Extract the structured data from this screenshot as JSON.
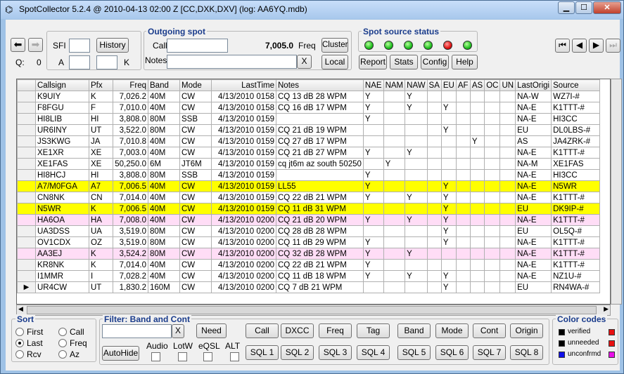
{
  "window": {
    "title": "SpotCollector 5.2.4 @ 2010-04-13  02:00 Z [CC,DXK,DXV]  (log: AA6YQ.mdb)",
    "app_icon": "binoculars-icon"
  },
  "sfi": {
    "label": "SFI",
    "value": ""
  },
  "a": {
    "label": "A",
    "value": ""
  },
  "k": {
    "label": "K",
    "value": ""
  },
  "q": {
    "label": "Q:",
    "value": "0"
  },
  "history_label": "History",
  "outgoing": {
    "title": "Outgoing spot",
    "call_label": "Call",
    "call_value": "",
    "freq_value": "7,005.0",
    "freq_label": "Freq",
    "notes_label": "Notes",
    "notes_value": "",
    "clear_label": "X",
    "cluster_label": "Cluster",
    "local_label": "Local"
  },
  "status": {
    "title": "Spot source status",
    "leds": [
      "#1fbf1f",
      "#1fbf1f",
      "#1fbf1f",
      "#1fbf1f",
      "#e01010",
      "#1fbf1f"
    ],
    "buttons": [
      "Report",
      "Stats",
      "Config",
      "Help"
    ]
  },
  "columns": [
    "",
    "Callsign",
    "Pfx",
    "Freq",
    "Band",
    "Mode",
    "LastTime",
    "Notes",
    "NAE",
    "NAM",
    "NAW",
    "SA",
    "EU",
    "AF",
    "AS",
    "OC",
    "UN",
    "LastOrigi",
    "Source"
  ],
  "rows": [
    {
      "style": "",
      "ind": "",
      "cells": [
        "K9UIY",
        "K",
        "7,026.2",
        "40M",
        "CW",
        "4/13/2010 0158",
        "CQ    13 dB 28 WPM",
        "Y",
        "",
        "Y",
        "",
        "",
        "",
        "",
        "",
        "",
        "NA-W",
        "WZ7I-#"
      ]
    },
    {
      "style": "",
      "ind": "",
      "cells": [
        "F8FGU",
        "F",
        "7,010.0",
        "40M",
        "CW",
        "4/13/2010 0158",
        "CQ    16 dB 17 WPM",
        "Y",
        "",
        "Y",
        "",
        "Y",
        "",
        "",
        "",
        "",
        "NA-E",
        "K1TTT-#"
      ]
    },
    {
      "style": "",
      "ind": "",
      "cells": [
        "HI8LIB",
        "HI",
        "3,808.0",
        "80M",
        "SSB",
        "4/13/2010 0159",
        "",
        "Y",
        "",
        "",
        "",
        "",
        "",
        "",
        "",
        "",
        "NA-E",
        "HI3CC"
      ]
    },
    {
      "style": "",
      "ind": "",
      "cells": [
        "UR6INY",
        "UT",
        "3,522.0",
        "80M",
        "CW",
        "4/13/2010 0159",
        "CQ    21 dB 19 WPM",
        "",
        "",
        "",
        "",
        "Y",
        "",
        "",
        "",
        "",
        "EU",
        "DL0LBS-#"
      ]
    },
    {
      "style": "",
      "ind": "",
      "cells": [
        "JS3KWG",
        "JA",
        "7,010.8",
        "40M",
        "CW",
        "4/13/2010 0159",
        "CQ    27 dB 17 WPM",
        "",
        "",
        "",
        "",
        "",
        "",
        "Y",
        "",
        "",
        "AS",
        "JA4ZRK-#"
      ]
    },
    {
      "style": "",
      "ind": "",
      "cells": [
        "XE1XR",
        "XE",
        "7,003.0",
        "40M",
        "CW",
        "4/13/2010 0159",
        "CQ    21 dB 27 WPM",
        "Y",
        "",
        "Y",
        "",
        "",
        "",
        "",
        "",
        "",
        "NA-E",
        "K1TTT-#"
      ]
    },
    {
      "style": "",
      "ind": "",
      "cells": [
        "XE1FAS",
        "XE",
        "50,250.0",
        "6M",
        "JT6M",
        "4/13/2010 0159",
        "cq jt6m az south 50250",
        "",
        "Y",
        "",
        "",
        "",
        "",
        "",
        "",
        "",
        "NA-M",
        "XE1FAS"
      ]
    },
    {
      "style": "",
      "ind": "",
      "cells": [
        "HI8HCJ",
        "HI",
        "3,808.0",
        "80M",
        "SSB",
        "4/13/2010 0159",
        "",
        "Y",
        "",
        "",
        "",
        "",
        "",
        "",
        "",
        "",
        "NA-E",
        "HI3CC"
      ]
    },
    {
      "style": "yel",
      "ind": "",
      "cells": [
        "A7/M0FGA",
        "A7",
        "7,006.5",
        "40M",
        "CW",
        "4/13/2010 0159",
        "LL55",
        "Y",
        "",
        "",
        "",
        "Y",
        "",
        "",
        "",
        "",
        "NA-E",
        "N5WR"
      ]
    },
    {
      "style": "",
      "ind": "",
      "cells": [
        "CN8NK",
        "CN",
        "7,014.0",
        "40M",
        "CW",
        "4/13/2010 0159",
        "CQ    22 dB 21 WPM",
        "Y",
        "",
        "Y",
        "",
        "Y",
        "",
        "",
        "",
        "",
        "NA-E",
        "K1TTT-#"
      ]
    },
    {
      "style": "yel",
      "ind": "",
      "cells": [
        "N5WR",
        "K",
        "7,006.5",
        "40M",
        "CW",
        "4/13/2010 0159",
        "CQ    11 dB 31 WPM",
        "",
        "",
        "",
        "",
        "Y",
        "",
        "",
        "",
        "",
        "EU",
        "DK9IP-#"
      ]
    },
    {
      "style": "pink",
      "ind": "",
      "cells": [
        "HA6OA",
        "HA",
        "7,008.0",
        "40M",
        "CW",
        "4/13/2010 0200",
        "CQ    21 dB 20 WPM",
        "Y",
        "",
        "Y",
        "",
        "Y",
        "",
        "",
        "",
        "",
        "NA-E",
        "K1TTT-#"
      ]
    },
    {
      "style": "",
      "ind": "",
      "cells": [
        "UA3DSS",
        "UA",
        "3,519.0",
        "80M",
        "CW",
        "4/13/2010 0200",
        "CQ    28 dB 28 WPM",
        "",
        "",
        "",
        "",
        "Y",
        "",
        "",
        "",
        "",
        "EU",
        "OL5Q-#"
      ]
    },
    {
      "style": "",
      "ind": "",
      "cells": [
        "OV1CDX",
        "OZ",
        "3,519.0",
        "80M",
        "CW",
        "4/13/2010 0200",
        "CQ    11 dB 29 WPM",
        "Y",
        "",
        "",
        "",
        "Y",
        "",
        "",
        "",
        "",
        "NA-E",
        "K1TTT-#"
      ]
    },
    {
      "style": "pink",
      "ind": "",
      "cells": [
        "AA3EJ",
        "K",
        "3,524.2",
        "80M",
        "CW",
        "4/13/2010 0200",
        "CQ    32 dB 28 WPM",
        "Y",
        "",
        "Y",
        "",
        "",
        "",
        "",
        "",
        "",
        "NA-E",
        "K1TTT-#"
      ]
    },
    {
      "style": "",
      "ind": "",
      "cells": [
        "KR8NK",
        "K",
        "7,014.0",
        "40M",
        "CW",
        "4/13/2010 0200",
        "CQ    22 dB 21 WPM",
        "Y",
        "",
        "",
        "",
        "",
        "",
        "",
        "",
        "",
        "NA-E",
        "K1TTT-#"
      ]
    },
    {
      "style": "",
      "ind": "",
      "cells": [
        "I1MMR",
        "I",
        "7,028.2",
        "40M",
        "CW",
        "4/13/2010 0200",
        "CQ    11 dB 18 WPM",
        "Y",
        "",
        "Y",
        "",
        "Y",
        "",
        "",
        "",
        "",
        "NA-E",
        "NZ1U-#"
      ]
    },
    {
      "style": "",
      "ind": "▶",
      "cells": [
        "UR4CW",
        "UT",
        "1,830.2",
        "160M",
        "CW",
        "4/13/2010 0200",
        "CQ    7 dB 21 WPM",
        "",
        "",
        "",
        "",
        "Y",
        "",
        "",
        "",
        "",
        "EU",
        "RN4WA-#"
      ]
    }
  ],
  "sort": {
    "title": "Sort",
    "options": [
      "First",
      "Call",
      "Last",
      "Freq",
      "Rcv",
      "Az"
    ],
    "selected": "Last"
  },
  "filter": {
    "title": "Filter: Band and Cont",
    "value": "",
    "clear_label": "X",
    "need_label": "Need",
    "autohide_label": "AutoHide",
    "checks": [
      "Audio",
      "LotW",
      "eQSL",
      "ALT"
    ],
    "buttons_row1": [
      "Call",
      "DXCC",
      "Freq",
      "Tag",
      "Band",
      "Mode",
      "Cont",
      "Origin"
    ],
    "buttons_row2": [
      "SQL 1",
      "SQL 2",
      "SQL 3",
      "SQL 4",
      "SQL 5",
      "SQL 6",
      "SQL 7",
      "SQL 8"
    ]
  },
  "color_codes": {
    "title": "Color codes",
    "items": [
      {
        "label": "verified",
        "left": "#000000",
        "right": "#e81010"
      },
      {
        "label": "unneeded",
        "left": "#000000",
        "right": "#e81010"
      },
      {
        "label": "unconfrmd",
        "left": "#1010e8",
        "right": "#e810e8"
      }
    ]
  }
}
